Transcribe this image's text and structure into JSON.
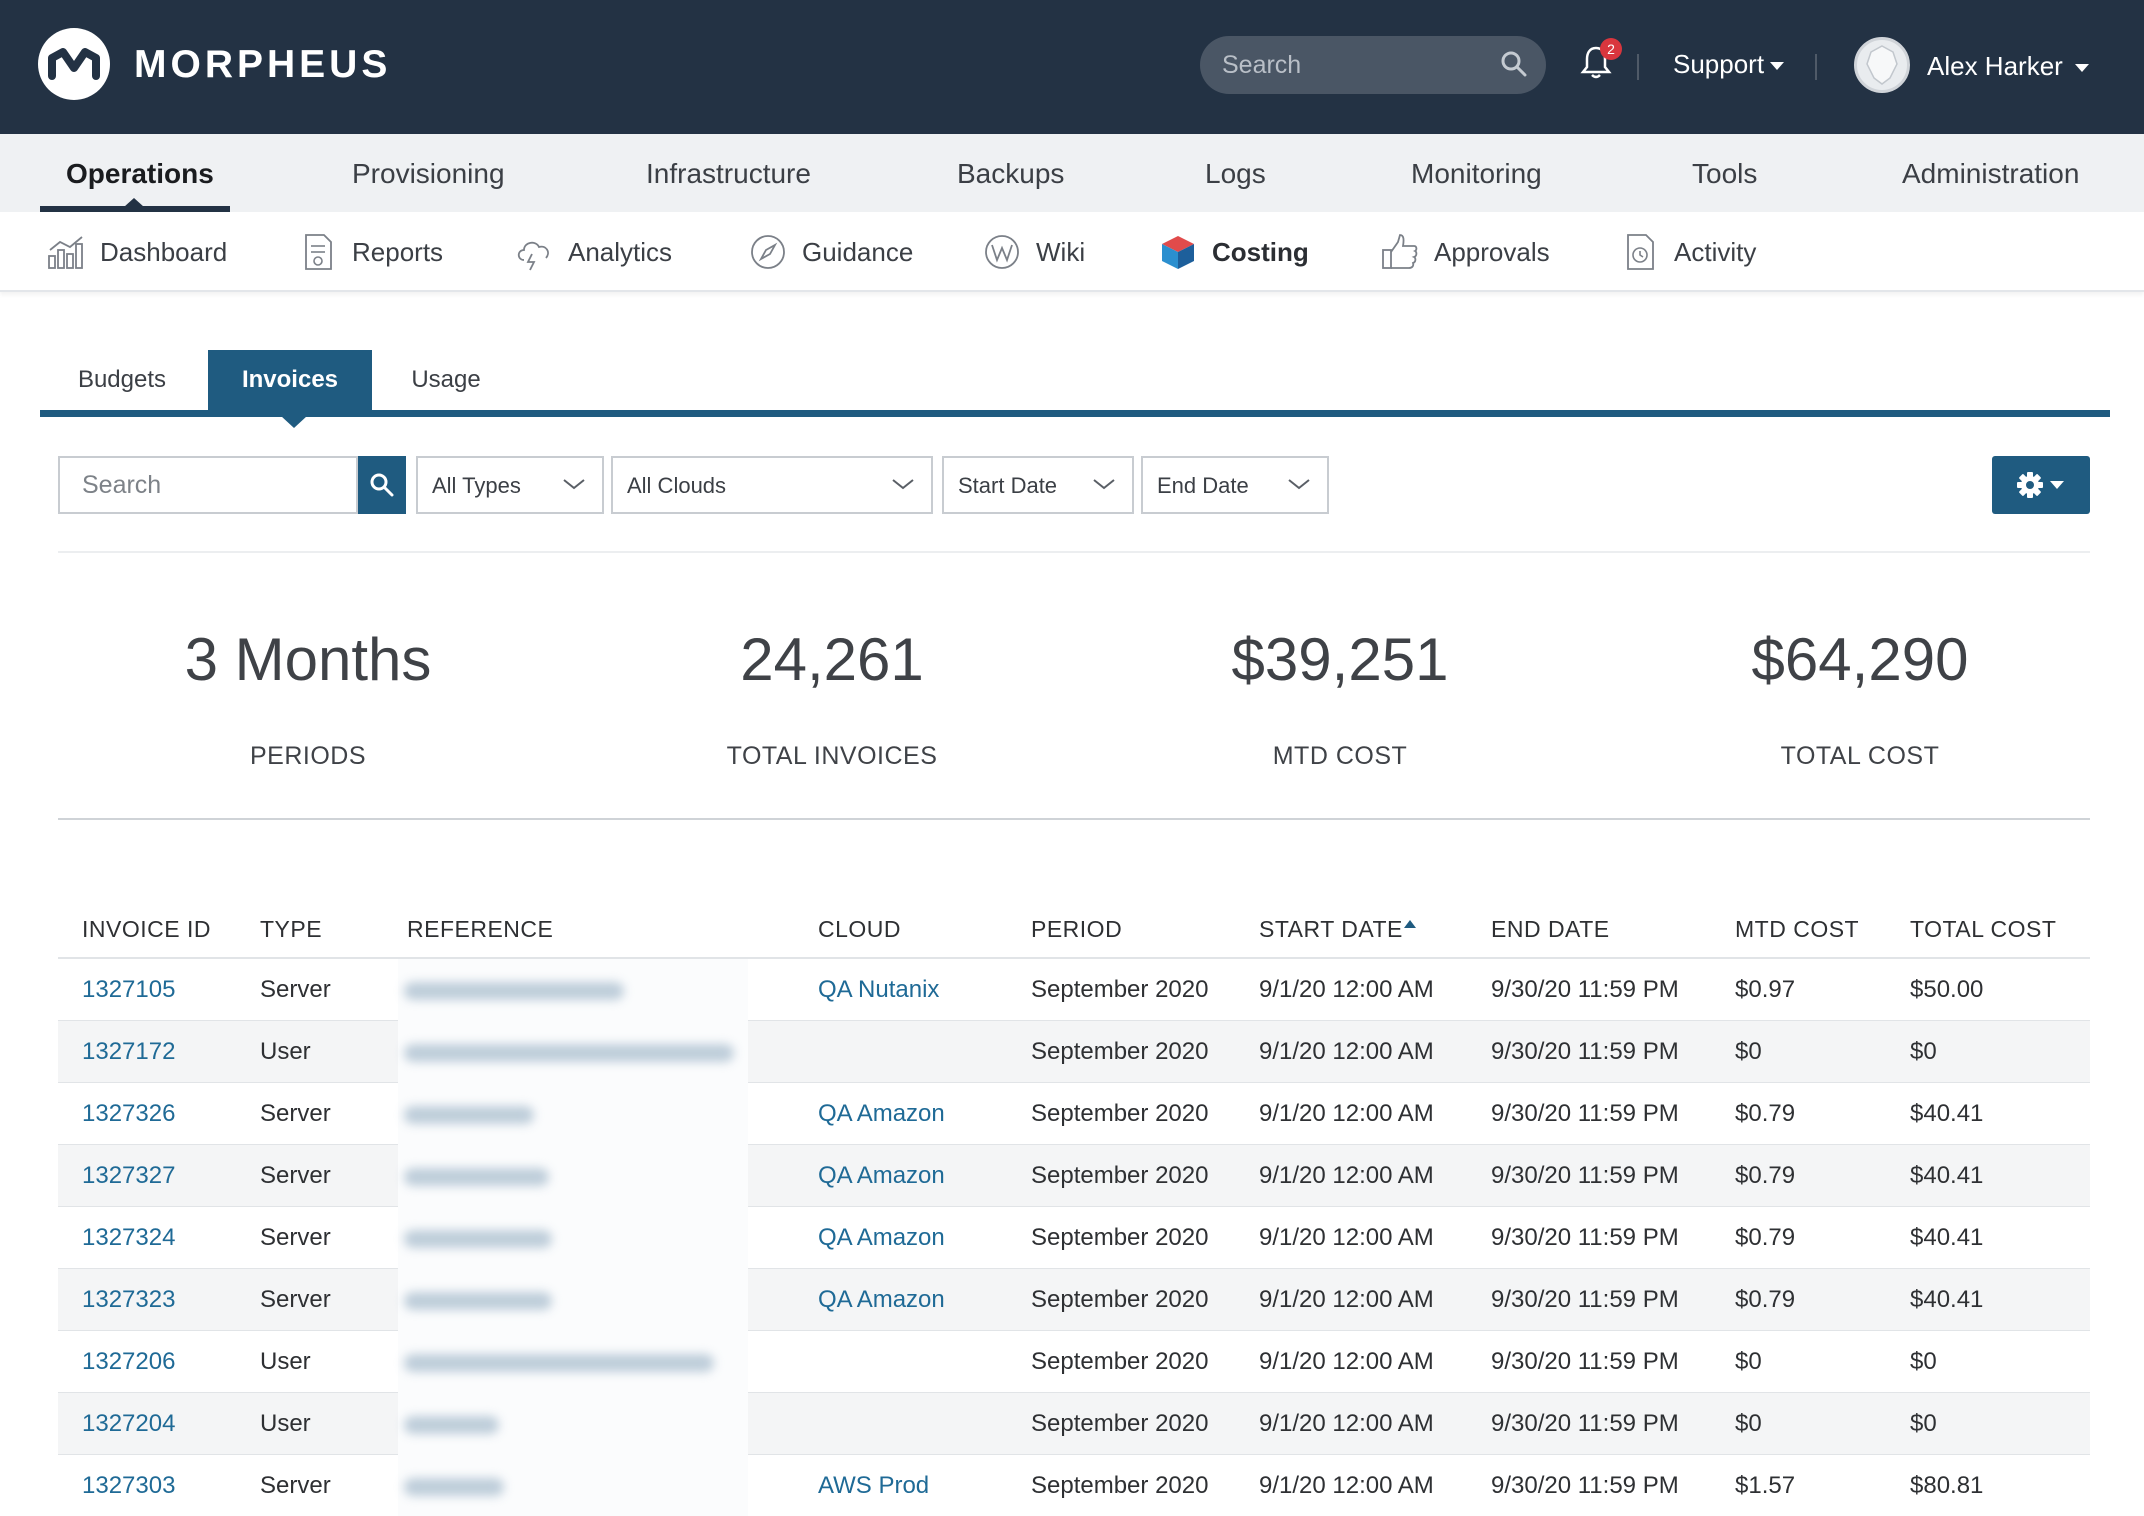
{
  "header": {
    "brand": "MORPHEUS",
    "search_placeholder": "Search",
    "notification_count": "2",
    "support_label": "Support",
    "user_name": "Alex Harker"
  },
  "main_nav": {
    "items": [
      {
        "label": "Operations",
        "active": true
      },
      {
        "label": "Provisioning"
      },
      {
        "label": "Infrastructure"
      },
      {
        "label": "Backups"
      },
      {
        "label": "Logs"
      },
      {
        "label": "Monitoring"
      },
      {
        "label": "Tools"
      },
      {
        "label": "Administration"
      }
    ]
  },
  "sub_nav": {
    "items": [
      {
        "label": "Dashboard",
        "icon": "dashboard-icon"
      },
      {
        "label": "Reports",
        "icon": "reports-icon"
      },
      {
        "label": "Analytics",
        "icon": "analytics-icon"
      },
      {
        "label": "Guidance",
        "icon": "guidance-icon"
      },
      {
        "label": "Wiki",
        "icon": "wiki-icon"
      },
      {
        "label": "Costing",
        "icon": "costing-icon",
        "active": true
      },
      {
        "label": "Approvals",
        "icon": "approvals-icon"
      },
      {
        "label": "Activity",
        "icon": "activity-icon"
      }
    ]
  },
  "tabs": {
    "items": [
      {
        "label": "Budgets"
      },
      {
        "label": "Invoices",
        "active": true
      },
      {
        "label": "Usage"
      }
    ]
  },
  "filters": {
    "search_placeholder": "Search",
    "types": "All Types",
    "clouds": "All Clouds",
    "start_date": "Start Date",
    "end_date": "End Date"
  },
  "stats": [
    {
      "value": "3 Months",
      "label": "PERIODS"
    },
    {
      "value": "24,261",
      "label": "TOTAL INVOICES"
    },
    {
      "value": "$39,251",
      "label": "MTD COST"
    },
    {
      "value": "$64,290",
      "label": "TOTAL COST"
    }
  ],
  "table": {
    "columns": [
      "INVOICE ID",
      "TYPE",
      "REFERENCE",
      "CLOUD",
      "PERIOD",
      "START DATE",
      "END DATE",
      "MTD COST",
      "TOTAL COST"
    ],
    "sorted_column": "START DATE",
    "rows": [
      {
        "id": "1327105",
        "type": "Server",
        "cloud": "QA Nutanix",
        "period": "September 2020",
        "start": "9/1/20 12:00 AM",
        "end": "9/30/20 11:59 PM",
        "mtd": "$0.97",
        "total": "$50.00"
      },
      {
        "id": "1327172",
        "type": "User",
        "cloud": "",
        "period": "September 2020",
        "start": "9/1/20 12:00 AM",
        "end": "9/30/20 11:59 PM",
        "mtd": "$0",
        "total": "$0"
      },
      {
        "id": "1327326",
        "type": "Server",
        "cloud": "QA Amazon",
        "period": "September 2020",
        "start": "9/1/20 12:00 AM",
        "end": "9/30/20 11:59 PM",
        "mtd": "$0.79",
        "total": "$40.41"
      },
      {
        "id": "1327327",
        "type": "Server",
        "cloud": "QA Amazon",
        "period": "September 2020",
        "start": "9/1/20 12:00 AM",
        "end": "9/30/20 11:59 PM",
        "mtd": "$0.79",
        "total": "$40.41"
      },
      {
        "id": "1327324",
        "type": "Server",
        "cloud": "QA Amazon",
        "period": "September 2020",
        "start": "9/1/20 12:00 AM",
        "end": "9/30/20 11:59 PM",
        "mtd": "$0.79",
        "total": "$40.41"
      },
      {
        "id": "1327323",
        "type": "Server",
        "cloud": "QA Amazon",
        "period": "September 2020",
        "start": "9/1/20 12:00 AM",
        "end": "9/30/20 11:59 PM",
        "mtd": "$0.79",
        "total": "$40.41"
      },
      {
        "id": "1327206",
        "type": "User",
        "cloud": "",
        "period": "September 2020",
        "start": "9/1/20 12:00 AM",
        "end": "9/30/20 11:59 PM",
        "mtd": "$0",
        "total": "$0"
      },
      {
        "id": "1327204",
        "type": "User",
        "cloud": "",
        "period": "September 2020",
        "start": "9/1/20 12:00 AM",
        "end": "9/30/20 11:59 PM",
        "mtd": "$0",
        "total": "$0"
      },
      {
        "id": "1327303",
        "type": "Server",
        "cloud": "AWS Prod",
        "period": "September 2020",
        "start": "9/1/20 12:00 AM",
        "end": "9/30/20 11:59 PM",
        "mtd": "$1.57",
        "total": "$80.81"
      }
    ]
  },
  "colors": {
    "header_bg": "#233244",
    "accent": "#1f5b80",
    "link": "#1f6a96",
    "badge": "#d9363e"
  }
}
